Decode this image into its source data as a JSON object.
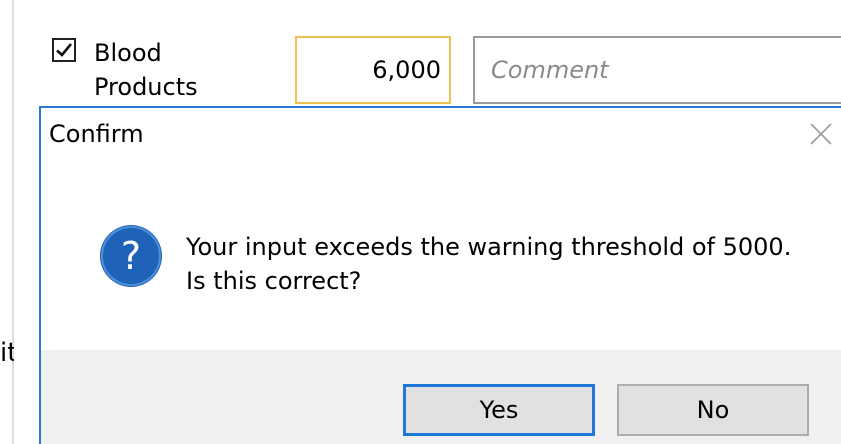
{
  "background_form": {
    "checkbox_checked": true,
    "item_label_line1": "Blood",
    "item_label_line2": "Products",
    "amount_value": "6,000",
    "comment_placeholder": "Comment",
    "left_fragment_text": "it"
  },
  "dialog": {
    "title": "Confirm",
    "icon": "question-icon",
    "message_line1": "Your input exceeds the warning threshold of 5000.",
    "message_line2": "Is this correct?",
    "yes_label": "Yes",
    "no_label": "No",
    "close_icon": "close-icon"
  },
  "colors": {
    "accent": "#2b79d6",
    "question_icon_bg": "#1e63b8",
    "amount_border": "#f0c050",
    "footer_bg": "#f0f0f0",
    "button_bg": "#e1e1e1"
  }
}
